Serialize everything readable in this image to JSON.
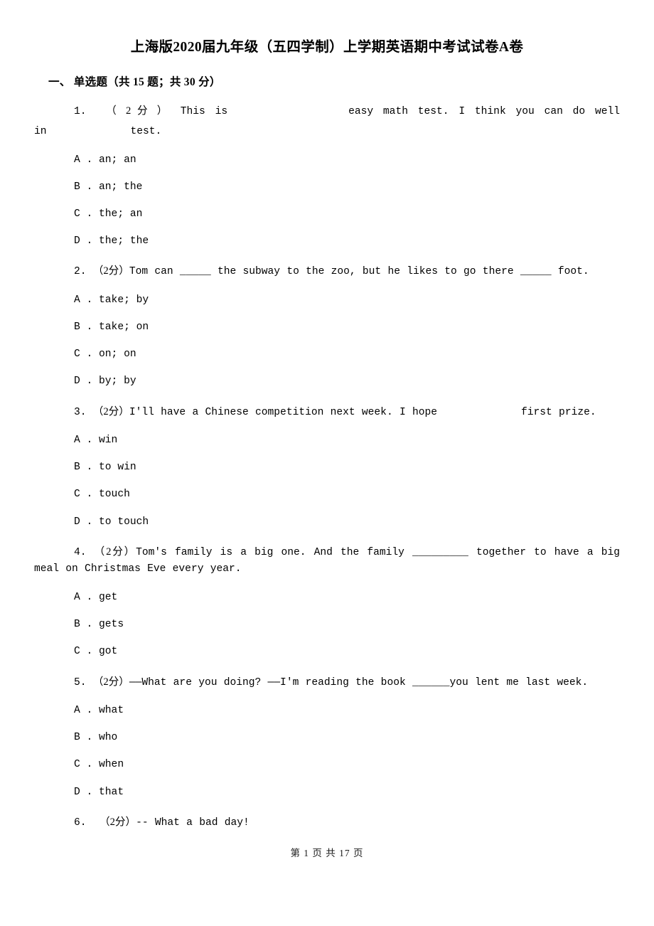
{
  "document": {
    "title": "上海版2020届九年级（五四学制）上学期英语期中考试试卷A卷",
    "footer": "第 1 页 共 17 页"
  },
  "section": {
    "heading": "一、  单选题（共 15 题；共 30 分）"
  },
  "questions": [
    {
      "number": "1.",
      "score": "（ 2 分 ）",
      "stem_part1": "This  is",
      "stem_part2": "easy  math  test.  I  think  you  can  do  well",
      "stem_part3": "in",
      "stem_part4": "test.",
      "options": [
        {
          "label": "A .",
          "text": "an; an"
        },
        {
          "label": "B .",
          "text": "an; the"
        },
        {
          "label": "C .",
          "text": "the; an"
        },
        {
          "label": "D .",
          "text": "the; the"
        }
      ]
    },
    {
      "number": "2.",
      "score": "（2分）",
      "stem": "Tom can _____ the subway to the zoo, but he likes to go there _____ foot.",
      "options": [
        {
          "label": "A .",
          "text": "take; by"
        },
        {
          "label": "B .",
          "text": "take; on"
        },
        {
          "label": "C .",
          "text": "on; on"
        },
        {
          "label": "D .",
          "text": "by; by"
        }
      ]
    },
    {
      "number": "3.",
      "score": "（2分）",
      "stem_part1": "I'll have a Chinese competition next week. I hope",
      "stem_part2": "first prize.",
      "options": [
        {
          "label": "A .",
          "text": "win"
        },
        {
          "label": "B .",
          "text": "to win"
        },
        {
          "label": "C .",
          "text": "touch"
        },
        {
          "label": "D .",
          "text": "to touch"
        }
      ]
    },
    {
      "number": "4.",
      "score": "（2分）",
      "stem": "Tom's family is a big one. And the family _________ together to have a big meal on Christmas Eve every year.",
      "options": [
        {
          "label": "A .",
          "text": "get"
        },
        {
          "label": "B .",
          "text": "gets"
        },
        {
          "label": "C .",
          "text": "got"
        }
      ]
    },
    {
      "number": "5.",
      "score": "（2分）",
      "stem": "——What are you doing? ——I'm reading the book ______you lent me last week.",
      "options": [
        {
          "label": "A .",
          "text": "what"
        },
        {
          "label": "B .",
          "text": "who"
        },
        {
          "label": "C .",
          "text": "when"
        },
        {
          "label": "D .",
          "text": "that"
        }
      ]
    },
    {
      "number": "6.",
      "score": "（2分）",
      "stem": "-- What a bad day!",
      "options": []
    }
  ]
}
